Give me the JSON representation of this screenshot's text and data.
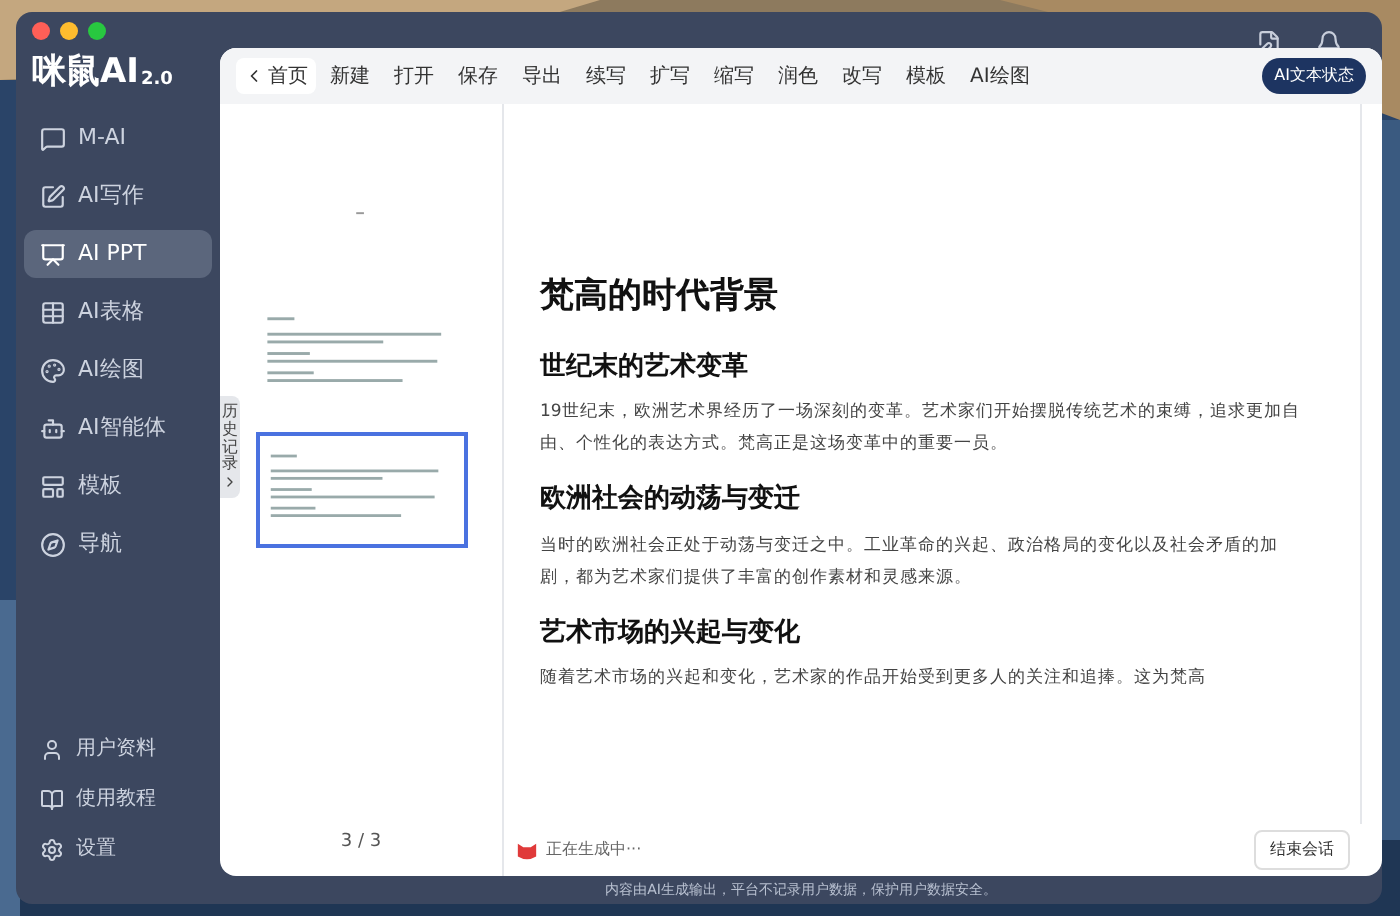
{
  "app": {
    "logo": "咪鼠AI",
    "version": "2.0"
  },
  "sidebar": {
    "items": [
      {
        "label": "M-AI",
        "selected": false
      },
      {
        "label": "AI写作",
        "selected": false
      },
      {
        "label": "AI PPT",
        "selected": true
      },
      {
        "label": "AI表格",
        "selected": false
      },
      {
        "label": "AI绘图",
        "selected": false
      },
      {
        "label": "AI智能体",
        "selected": false
      },
      {
        "label": "模板",
        "selected": false
      },
      {
        "label": "导航",
        "selected": false
      }
    ],
    "bottom_items": [
      {
        "label": "用户资料"
      },
      {
        "label": "使用教程"
      },
      {
        "label": "设置"
      }
    ]
  },
  "toolbar": {
    "back": "首页",
    "items": [
      "新建",
      "打开",
      "保存",
      "导出",
      "续写",
      "扩写",
      "缩写",
      "润色",
      "改写",
      "模板",
      "AI绘图"
    ],
    "status_badge": "AI文本状态"
  },
  "thumbnails": {
    "slides": [
      {
        "selected": false
      },
      {
        "selected": false
      },
      {
        "selected": true
      }
    ],
    "history_tab": "历史记录",
    "page_counter": "3 / 3"
  },
  "document": {
    "title": "梵高的时代背景",
    "sections": [
      {
        "heading": "世纪末的艺术变革",
        "body": "19世纪末，欧洲艺术界经历了一场深刻的变革。艺术家们开始摆脱传统艺术的束缚，追求更加自由、个性化的表达方式。梵高正是这场变革中的重要一员。"
      },
      {
        "heading": "欧洲社会的动荡与变迁",
        "body": "当时的欧洲社会正处于动荡与变迁之中。工业革命的兴起、政治格局的变化以及社会矛盾的加剧，都为艺术家们提供了丰富的创作素材和灵感来源。"
      },
      {
        "heading": "艺术市场的兴起与变化",
        "body": "随着艺术市场的兴起和变化，艺术家的作品开始受到更多人的关注和追捧。这为梵高"
      }
    ],
    "status": "正在生成中···",
    "end_button": "结束会话"
  },
  "footer": "内容由AI生成输出，平台不记录用户数据，保护用户数据安全。"
}
